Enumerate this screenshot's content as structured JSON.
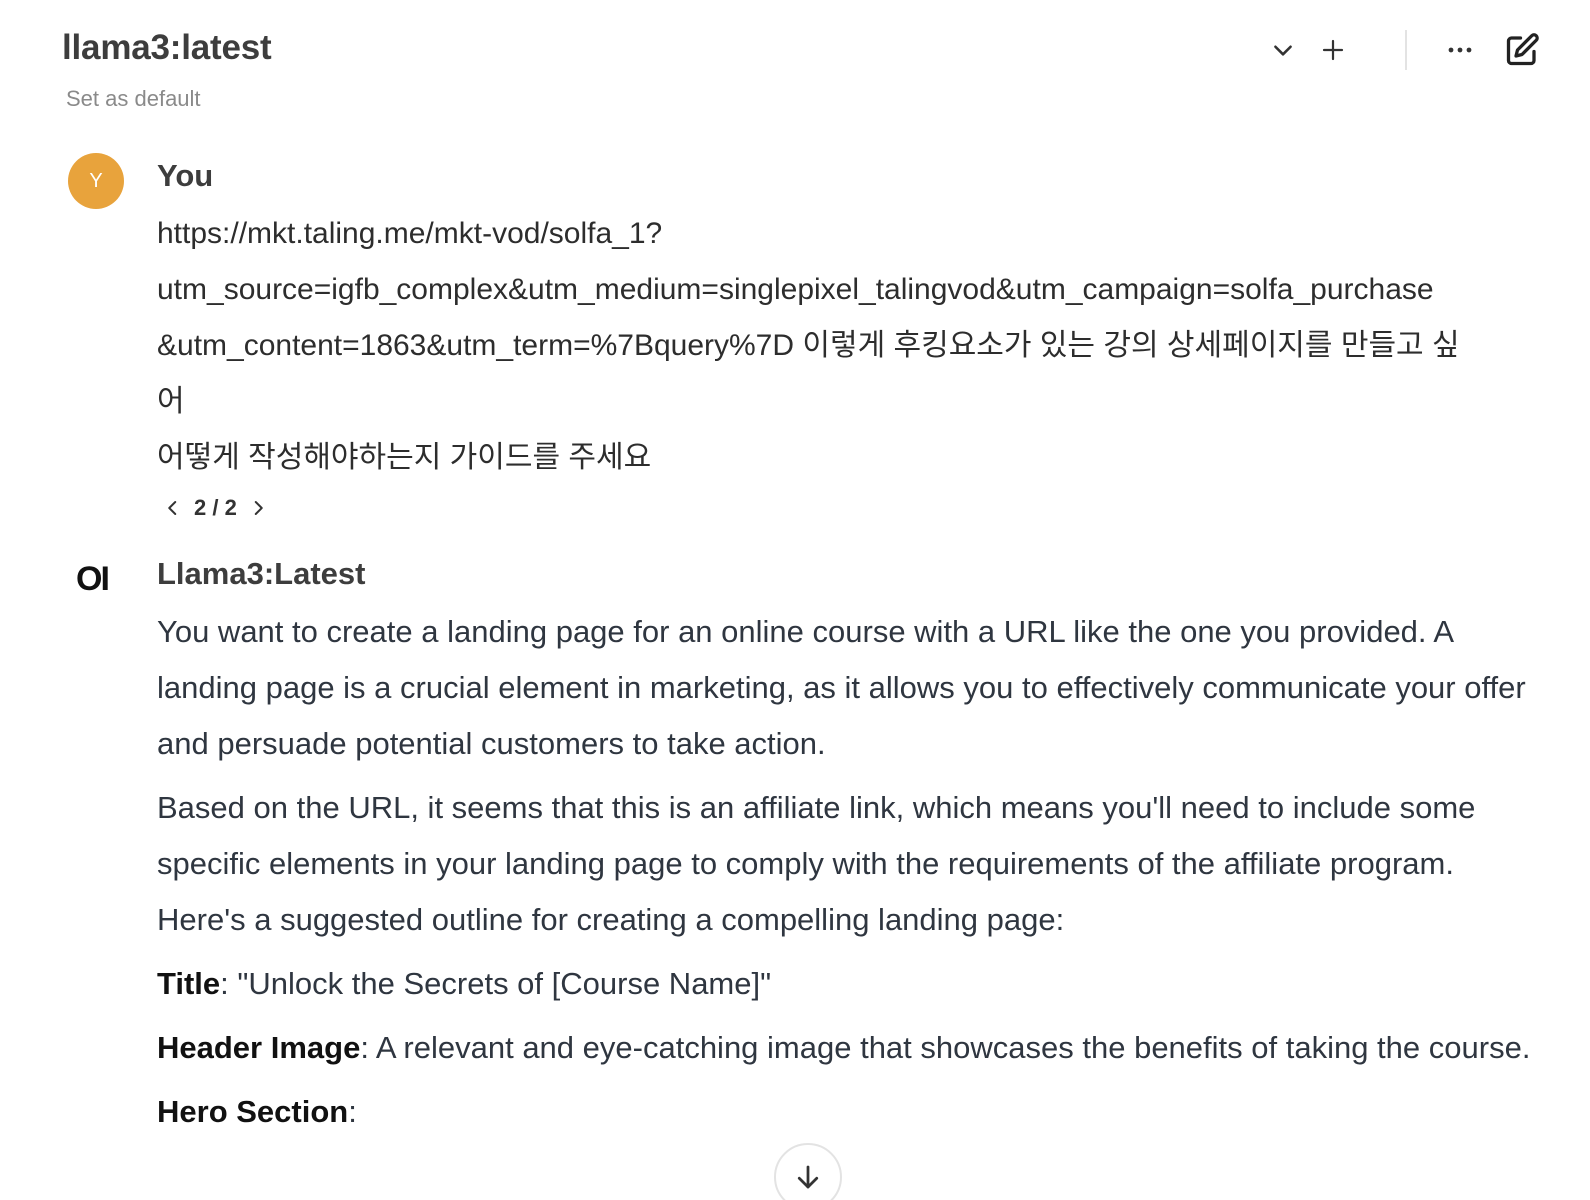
{
  "header": {
    "model_title": "llama3:latest",
    "set_default_label": "Set as default",
    "icons": [
      "chevron-down-icon",
      "plus-icon",
      "more-horizontal-icon",
      "edit-icon"
    ]
  },
  "user_message": {
    "avatar_letter": "Y",
    "avatar_color": "#e8a33c",
    "author": "You",
    "lines": [
      "https://mkt.taling.me/mkt-vod/solfa_1?",
      "utm_source=igfb_complex&utm_medium=singlepixel_talingvod&utm_campaign=solfa_purchase",
      "&utm_content=1863&utm_term=%7Bquery%7D 이렇게 후킹요소가 있는 강의 상세페이지를 만들고 싶",
      "어",
      "어떻게 작성해야하는지 가이드를 주세요"
    ],
    "pager": "2 / 2"
  },
  "assistant_message": {
    "logo_text": "OI",
    "author": "Llama3:Latest",
    "paragraph1": "You want to create a landing page for an online course with a URL like the one you provided. A landing page is a crucial element in marketing, as it allows you to effectively communicate your offer and persuade potential customers to take action.",
    "paragraph2": "Based on the URL, it seems that this is an affiliate link, which means you'll need to include some specific elements in your landing page to comply with the requirements of the affiliate program. Here's a suggested outline for creating a compelling landing page:",
    "title_label": "Title",
    "title_value": ": \"Unlock the Secrets of [Course Name]\"",
    "header_image_label": "Header Image",
    "header_image_value": ": A relevant and eye-catching image that showcases the benefits of taking the course.",
    "hero_label": "Hero Section",
    "hero_value": ":"
  }
}
